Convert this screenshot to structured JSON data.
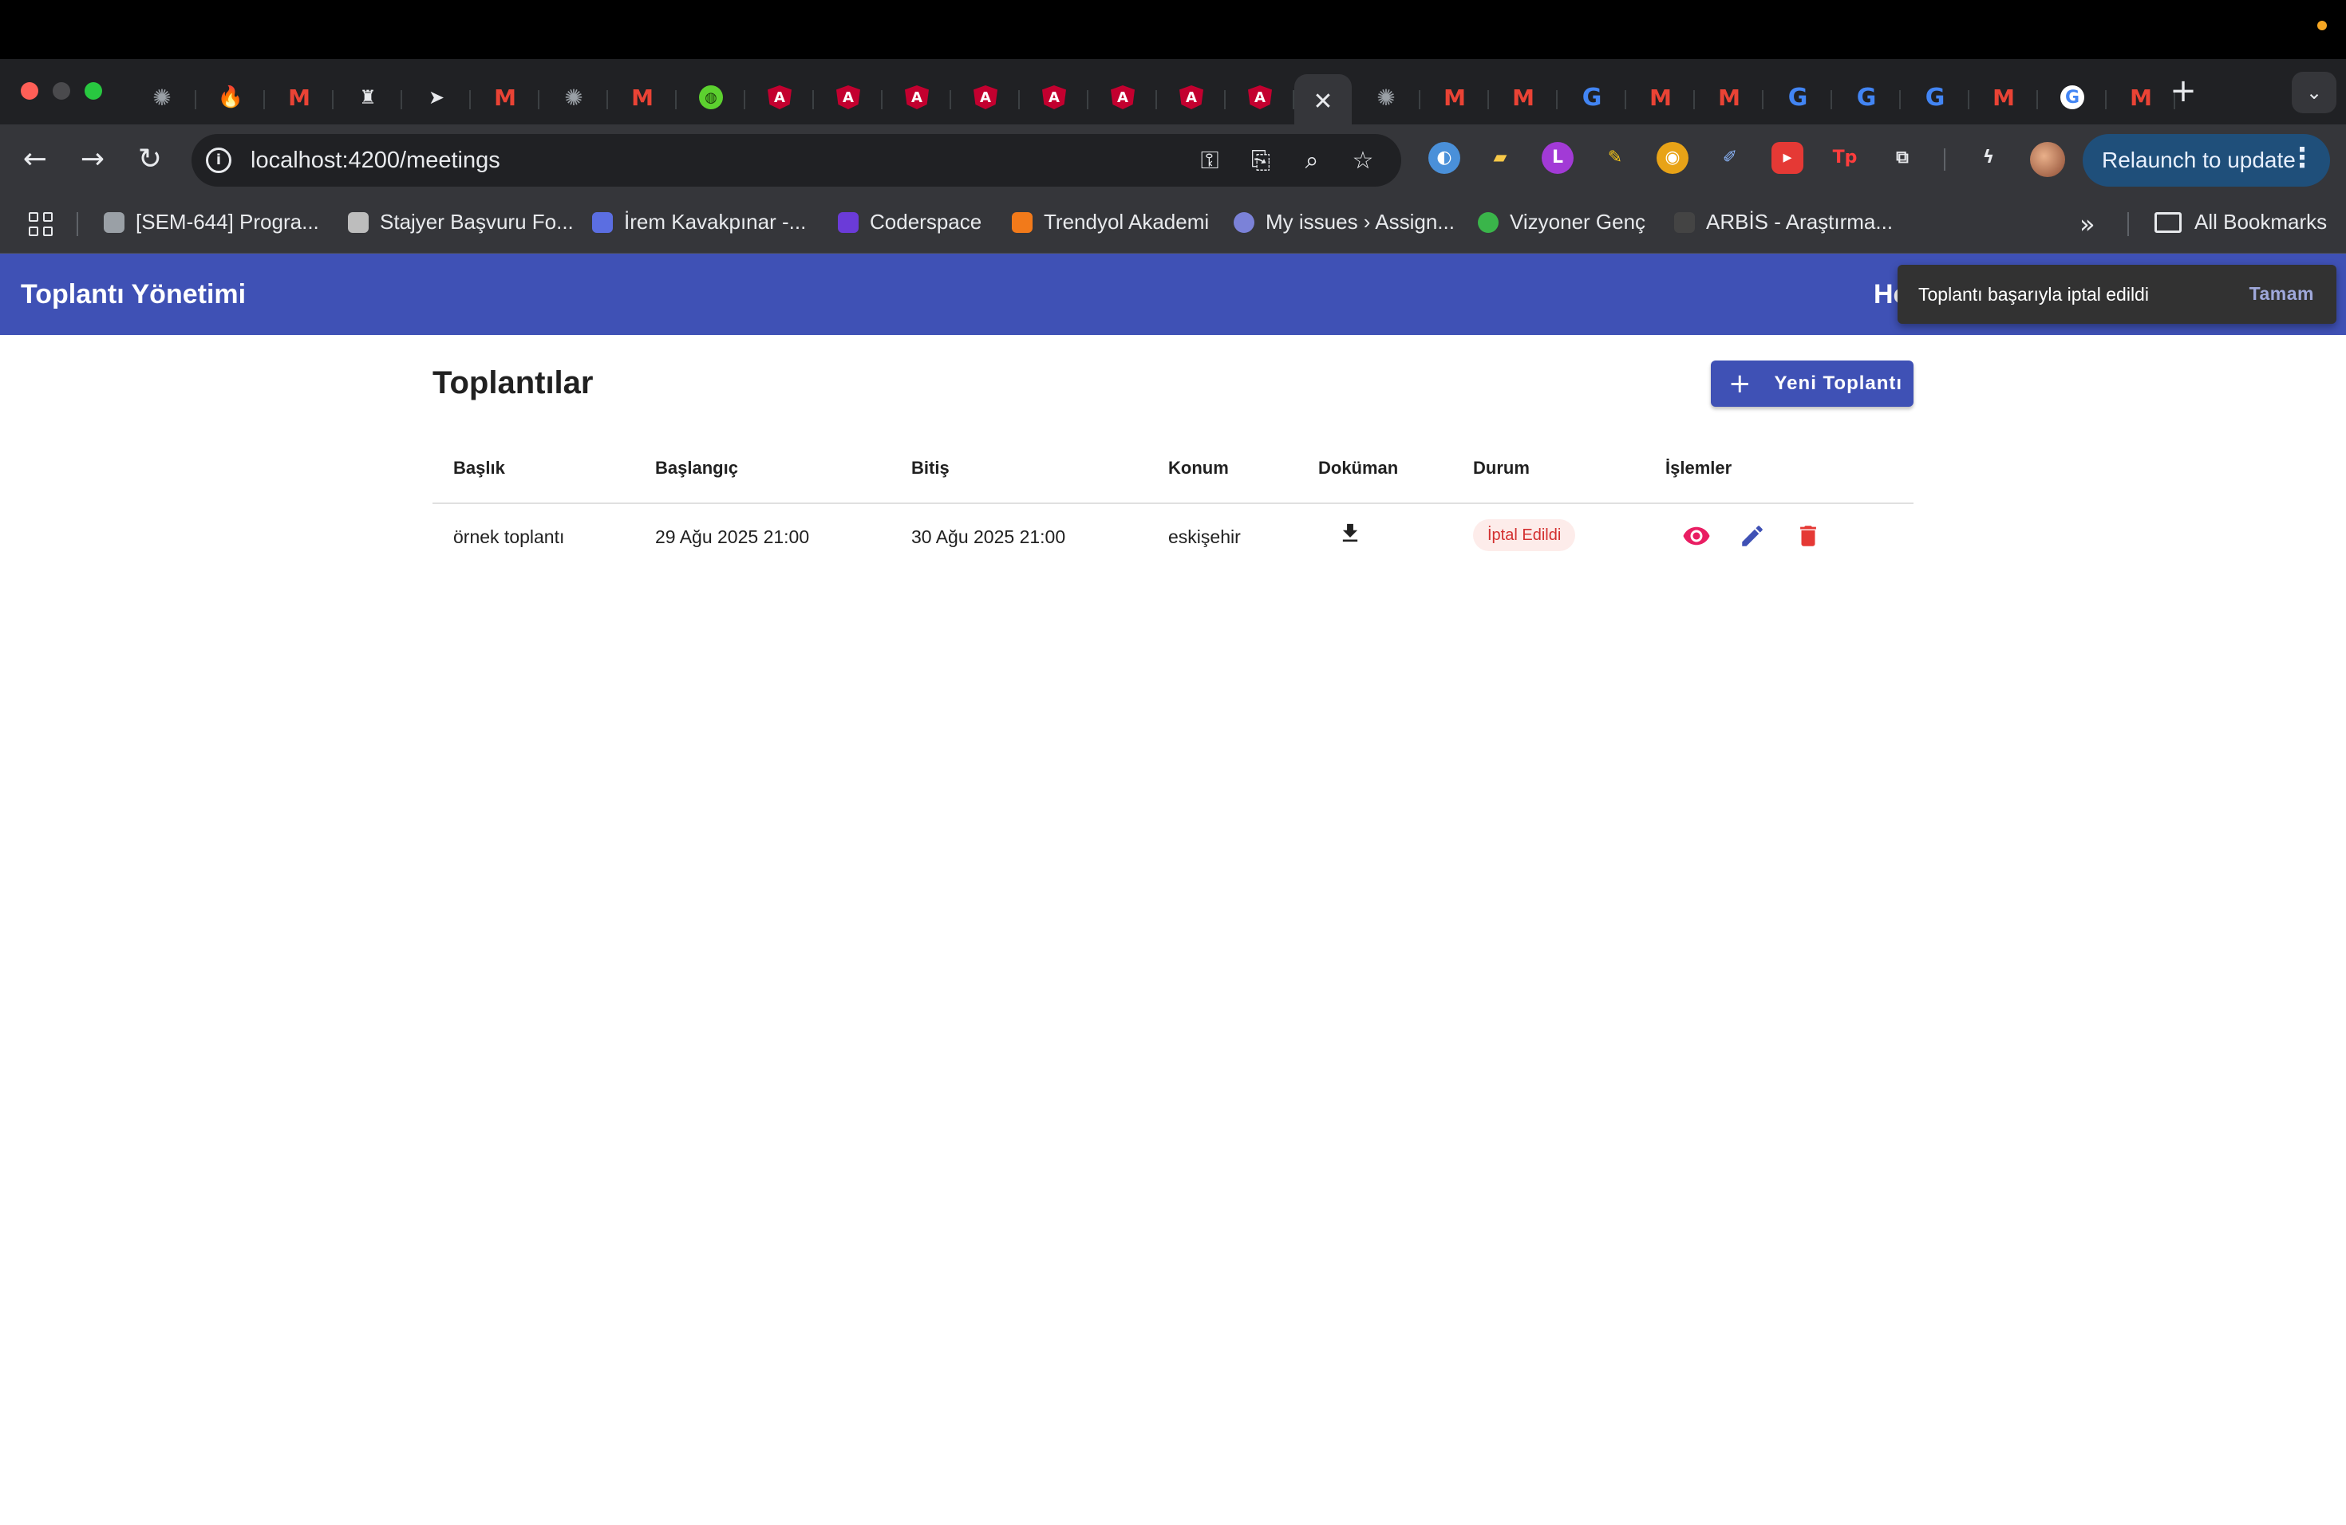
{
  "browser": {
    "url": "localhost:4200/meetings",
    "relaunch_label": "Relaunch to update",
    "tab_favicons": [
      "chatgpt-icon",
      "fire-icon",
      "gmail-icon",
      "ghost-icon",
      "send-icon",
      "gmail-icon",
      "chatgpt-icon",
      "gmail-icon",
      "globe-icon",
      "angular-icon",
      "angular-icon",
      "angular-icon",
      "angular-icon",
      "angular-icon",
      "angular-icon",
      "angular-icon",
      "angular-icon",
      "close-icon",
      "chatgpt-icon",
      "gmail-icon",
      "gmail-icon",
      "google-icon",
      "gmail-icon",
      "gmail-icon",
      "google-icon",
      "google-icon",
      "google-icon",
      "gmail-icon",
      "google-icon",
      "gmail-icon"
    ],
    "bookmarks": [
      {
        "label": "[SEM-644] Progra...",
        "icon": "feather-icon",
        "color": "#9aa0a6"
      },
      {
        "label": "Stajyer Başvuru Fo...",
        "icon": "cube-icon",
        "color": "#bdbdbd"
      },
      {
        "label": "İrem Kavakpınar -...",
        "icon": "profile-icon",
        "color": "#5b6ee1"
      },
      {
        "label": "Coderspace",
        "icon": "coderspace-icon",
        "color": "#6b3bd8"
      },
      {
        "label": "Trendyol Akademi",
        "icon": "grad-cap-icon",
        "color": "#f27a1a"
      },
      {
        "label": "My issues › Assign...",
        "icon": "linear-icon",
        "color": "#7b82d8"
      },
      {
        "label": "Vizyoner Genç",
        "icon": "vg-icon",
        "color": "#3ab54a"
      },
      {
        "label": "ARBİS - Araştırma...",
        "icon": "arbis-icon",
        "color": "#444444"
      }
    ],
    "all_bookmarks_label": "All Bookmarks"
  },
  "app": {
    "title": "Toplantı Yönetimi",
    "home_label": "Ho"
  },
  "page": {
    "title": "Toplantılar",
    "new_button_label": "Yeni Toplantı"
  },
  "table": {
    "headers": {
      "title": "Başlık",
      "start": "Başlangıç",
      "end": "Bitiş",
      "location": "Konum",
      "document": "Doküman",
      "status": "Durum",
      "actions": "İşlemler"
    },
    "rows": [
      {
        "title": "örnek toplantı",
        "start": "29 Ağu 2025 21:00",
        "end": "30 Ağu 2025 21:00",
        "location": "eskişehir",
        "status": "İptal Edildi",
        "status_color": "#d32f2f"
      }
    ]
  },
  "snackbar": {
    "message": "Toplantı başarıyla iptal edildi",
    "action": "Tamam"
  },
  "colors": {
    "primary": "#3f51b5",
    "view_icon": "#e91e63",
    "edit_icon": "#3f51b5",
    "delete_icon": "#e53935"
  }
}
